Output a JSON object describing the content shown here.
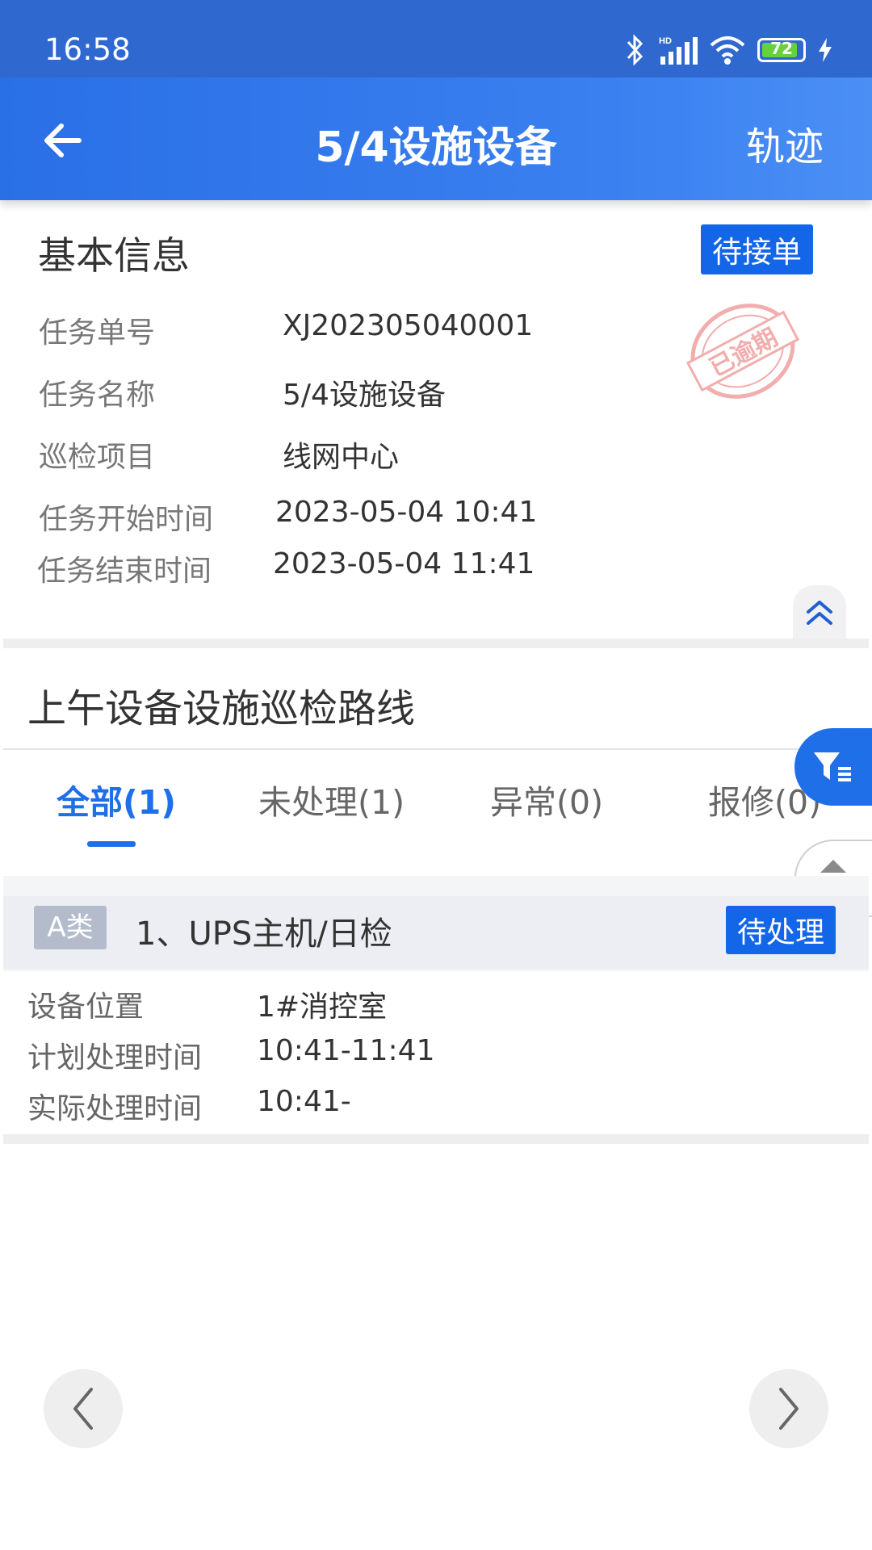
{
  "status_bar": {
    "time": "16:58",
    "battery": "72"
  },
  "header": {
    "title": "5/4设施设备",
    "right_action": "轨迹"
  },
  "basic_info": {
    "section_title": "基本信息",
    "status": "待接单",
    "overdue_stamp": "已逾期",
    "fields": [
      {
        "label": "任务单号",
        "value": "XJ202305040001"
      },
      {
        "label": "任务名称",
        "value": "5/4设施设备"
      },
      {
        "label": "巡检项目",
        "value": "线网中心"
      },
      {
        "label": "任务开始时间",
        "value": "2023-05-04 10:41"
      },
      {
        "label": "任务结束时间",
        "value": "2023-05-04 11:41"
      }
    ]
  },
  "route": {
    "title": "上午设备设施巡检路线"
  },
  "tabs": [
    {
      "label": "全部(1)",
      "active": true
    },
    {
      "label": "未处理(1)",
      "active": false
    },
    {
      "label": "异常(0)",
      "active": false
    },
    {
      "label": "报修(0)",
      "active": false
    }
  ],
  "items": [
    {
      "category": "A类",
      "title": "1、UPS主机/日检",
      "status": "待处理",
      "fields": [
        {
          "label": "设备位置",
          "value": "1#消控室"
        },
        {
          "label": "计划处理时间",
          "value": "10:41-11:41"
        },
        {
          "label": "实际处理时间",
          "value": "10:41-"
        }
      ]
    }
  ],
  "colors": {
    "primary": "#1f6fe8",
    "tag": "#1466e8",
    "category_tag": "#b4bccb"
  },
  "icons": {
    "back": "arrow-left-icon",
    "collapse": "double-chevron-up-icon",
    "filter": "filter-icon",
    "scroll": "scroll-toggle-icon",
    "prev": "chevron-left-icon",
    "next": "chevron-right-icon"
  }
}
